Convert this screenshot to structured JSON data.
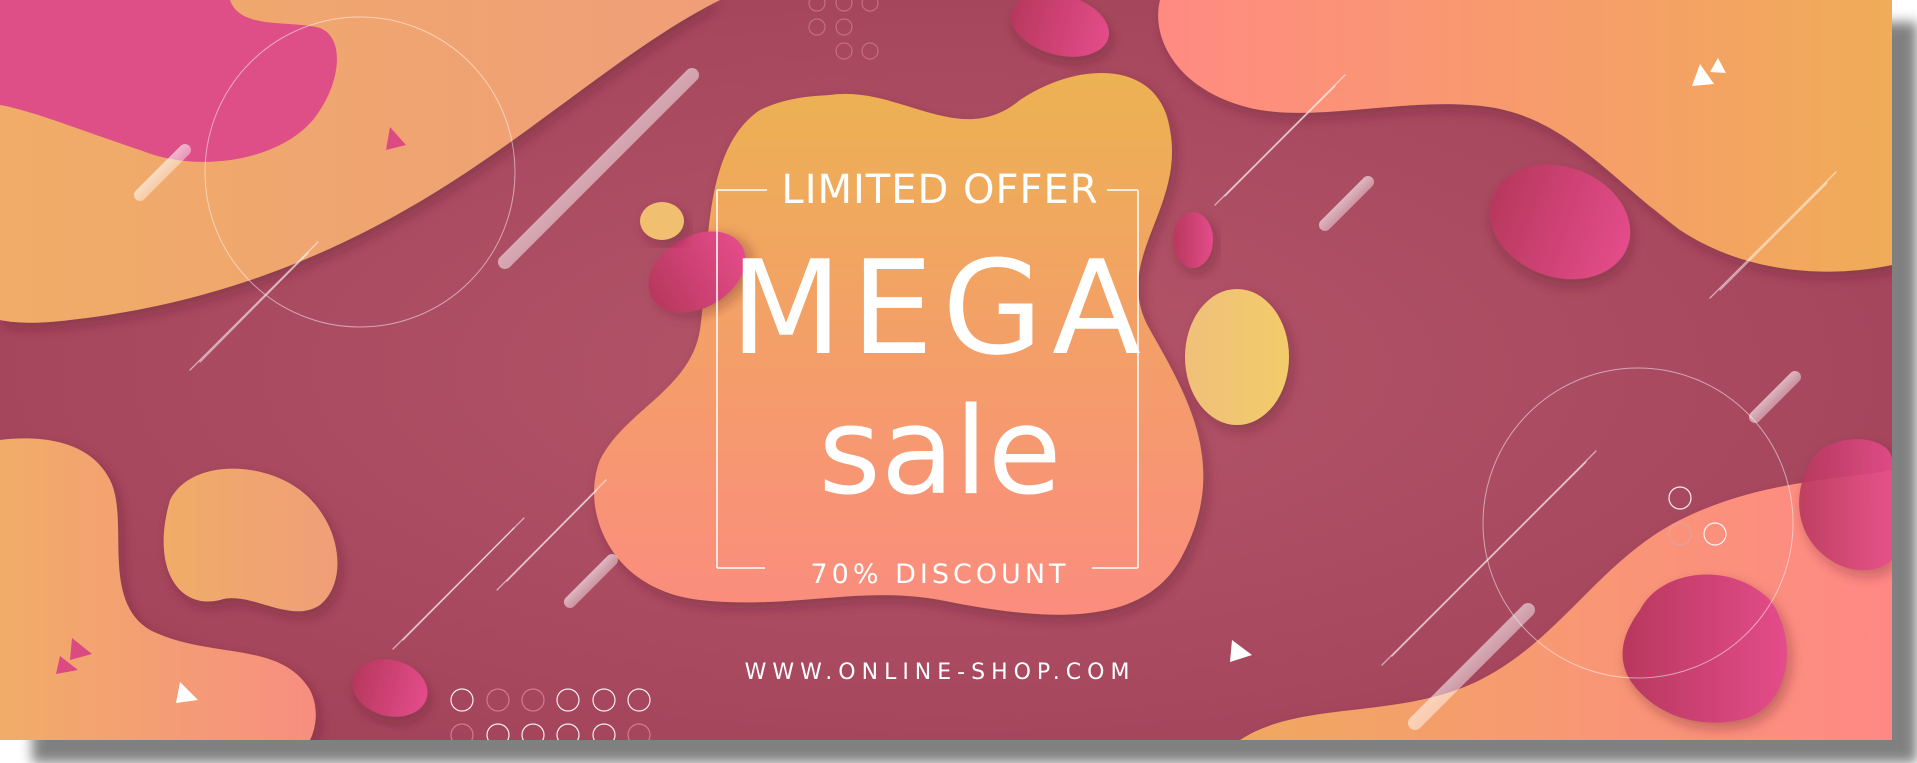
{
  "banner": {
    "headline_top": "LIMITED OFFER",
    "headline_main": "MEGA",
    "headline_sub": "sale",
    "discount": "70% DISCOUNT",
    "website": "WWW.ONLINE-SHOP.COM"
  },
  "colors": {
    "background": "#a44b5d",
    "peach": "#f39a7a",
    "orange": "#f0b05a",
    "pink": "#dc4a82",
    "yellow": "#f0c870",
    "text": "#ffffff"
  }
}
